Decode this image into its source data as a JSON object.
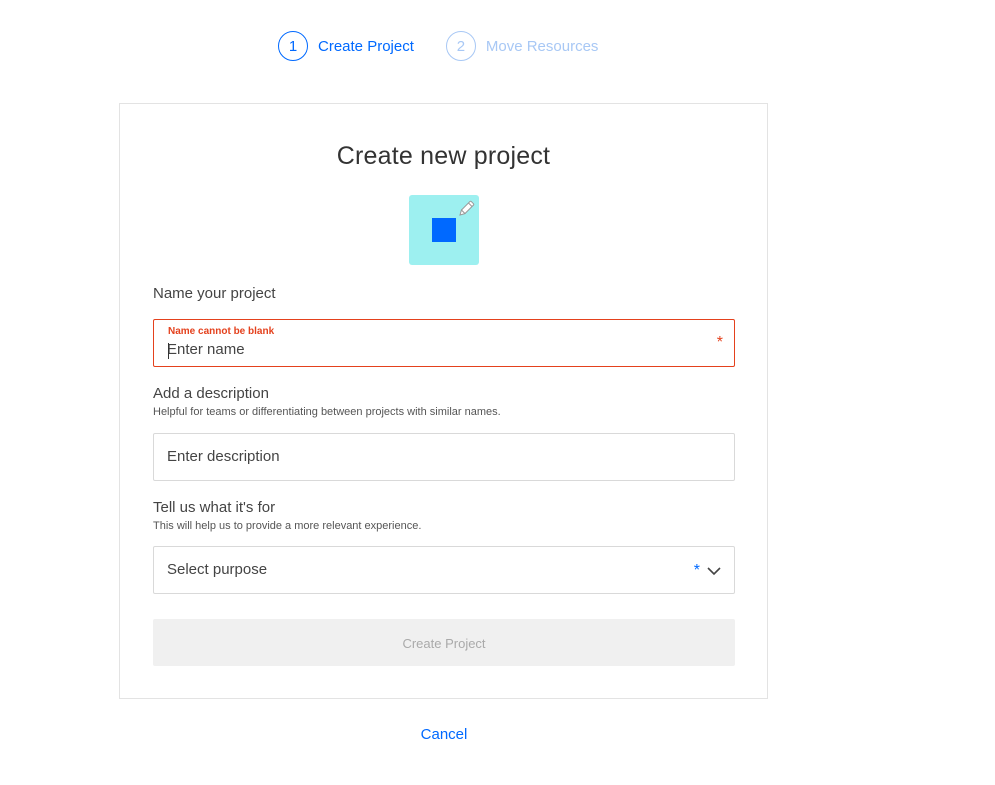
{
  "stepper": {
    "steps": [
      {
        "number": "1",
        "label": "Create Project"
      },
      {
        "number": "2",
        "label": "Move Resources"
      }
    ]
  },
  "card": {
    "title": "Create new project"
  },
  "name_section": {
    "label": "Name your project",
    "error": "Name cannot be blank",
    "placeholder": "Enter name",
    "required_mark": "*"
  },
  "description_section": {
    "label": "Add a description",
    "help": "Helpful for teams or differentiating between projects with similar names.",
    "placeholder": "Enter description"
  },
  "purpose_section": {
    "label": "Tell us what it's for",
    "help": "This will help us to provide a more relevant experience.",
    "selected": "Select purpose",
    "required_mark": "*"
  },
  "actions": {
    "submit_label": "Create Project",
    "cancel_label": "Cancel"
  },
  "colors": {
    "accent": "#0069ff",
    "error": "#e4411d",
    "icon_background": "#9df0f0"
  },
  "icons": {
    "project_icon": "project-square-icon",
    "edit_icon": "pencil-icon",
    "dropdown_icon": "chevron-down-icon"
  }
}
